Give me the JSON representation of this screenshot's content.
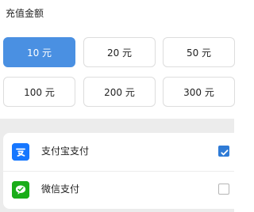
{
  "section": {
    "title": "充值金额"
  },
  "amounts": [
    {
      "label": "10 元",
      "selected": true
    },
    {
      "label": "20 元",
      "selected": false
    },
    {
      "label": "50 元",
      "selected": false
    },
    {
      "label": "100 元",
      "selected": false
    },
    {
      "label": "200 元",
      "selected": false
    },
    {
      "label": "300 元",
      "selected": false
    }
  ],
  "payment": {
    "methods": [
      {
        "label": "支付宝支付",
        "icon": "alipay-icon",
        "checked": true
      },
      {
        "label": "微信支付",
        "icon": "wechat-pay-icon",
        "checked": false
      }
    ]
  },
  "colors": {
    "accent": "#4a90e2",
    "alipay": "#1677ff",
    "wechat": "#1aad19",
    "checkbox": "#2f7bd6"
  }
}
